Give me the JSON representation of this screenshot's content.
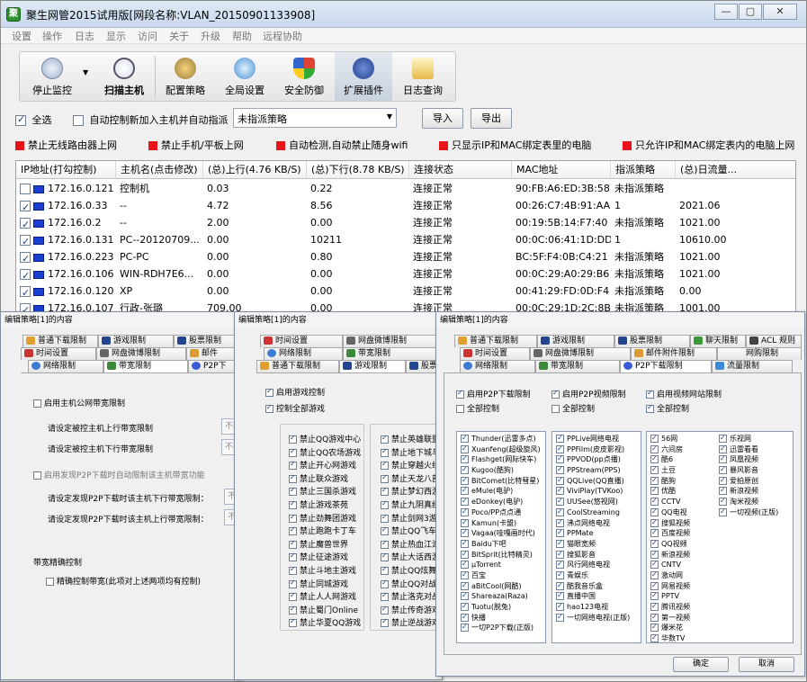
{
  "window": {
    "title": "聚生网管2015试用版[网段名称:VLAN_20150901133908]",
    "controls": [
      "—",
      "▢",
      "✕"
    ]
  },
  "menu": [
    "设置",
    "操作",
    "日志",
    "显示",
    "访问",
    "关于",
    "升级",
    "帮助",
    "远程协助"
  ],
  "toolbar": {
    "stop_monitor": "停止监控",
    "scan_host": "扫描主机",
    "config_policy": "配置策略",
    "global_settings": "全局设置",
    "security": "安全防御",
    "plugins": "扩展插件",
    "log_query": "日志查询"
  },
  "options": {
    "select_all": "全选",
    "auto_control": "自动控制新加入主机并自动指派",
    "policy_value": "未指派策略",
    "import": "导入",
    "export": "导出"
  },
  "flags": [
    "禁止无线路由器上网",
    "禁止手机/平板上网",
    "自动检测,自动禁止随身wifi",
    "只显示IP和MAC绑定表里的电脑",
    "只允许IP和MAC绑定表内的电脑上网"
  ],
  "table": {
    "headers": [
      "IP地址(打勾控制)",
      "主机名(点击修改)",
      "(总)上行(4.76 KB/S)",
      "(总)下行(8.78 KB/S)",
      "连接状态",
      "MAC地址",
      "指派策略",
      "(总)日流量..."
    ],
    "rows": [
      {
        "checked": false,
        "ip": "172.16.0.121",
        "host": "控制机",
        "up": "0.03",
        "down": "0.22",
        "status": "连接正常",
        "mac": "90:FB:A6:ED:3B:58",
        "policy": "未指派策略",
        "traffic": ""
      },
      {
        "checked": true,
        "ip": "172.16.0.33",
        "host": "--",
        "up": "4.72",
        "down": "8.56",
        "status": "连接正常",
        "mac": "00:26:C7:4B:91:AA",
        "policy": "1",
        "traffic": "2021.06"
      },
      {
        "checked": true,
        "ip": "172.16.0.2",
        "host": "--",
        "up": "2.00",
        "down": "0.00",
        "status": "连接正常",
        "mac": "00:19:5B:14:F7:40",
        "policy": "未指派策略",
        "traffic": "1021.00"
      },
      {
        "checked": true,
        "ip": "172.16.0.131",
        "host": "PC--20120709...",
        "up": "0.00",
        "down": "10211",
        "status": "连接正常",
        "mac": "00:0C:06:41:1D:DD",
        "policy": "1",
        "traffic": "10610.00"
      },
      {
        "checked": true,
        "ip": "172.16.0.223",
        "host": "PC-PC",
        "up": "0.00",
        "down": "0.80",
        "status": "连接正常",
        "mac": "BC:5F:F4:0B:C4:21",
        "policy": "未指派策略",
        "traffic": "1021.00"
      },
      {
        "checked": true,
        "ip": "172.16.0.106",
        "host": "WIN-RDH7E6...",
        "up": "0.00",
        "down": "0.00",
        "status": "连接正常",
        "mac": "00:0C:29:A0:29:B6",
        "policy": "未指派策略",
        "traffic": "1021.00"
      },
      {
        "checked": true,
        "ip": "172.16.0.120",
        "host": "XP",
        "up": "0.00",
        "down": "0.00",
        "status": "连接正常",
        "mac": "00:41:29:FD:0D:F4",
        "policy": "未指派策略",
        "traffic": "0.00"
      },
      {
        "checked": true,
        "ip": "172.16.0.107",
        "host": "行政-张璐",
        "up": "709.00",
        "down": "0.00",
        "status": "连接正常",
        "mac": "00:0C:29:1D:2C:8B",
        "policy": "未指派策略",
        "traffic": "1001.00"
      }
    ]
  },
  "dialog1": {
    "title": "编辑策略[1]的内容",
    "tabs_row1": [
      "普通下载限制",
      "游戏限制",
      "股票限制"
    ],
    "tabs_row2": [
      "时间设置",
      "网盘微博限制",
      "邮件"
    ],
    "tabs_row3": [
      "网络限制",
      "带宽限制",
      "P2P下"
    ],
    "enable_bandwidth": "启用主机公网带宽限制",
    "up_limit": "请设定被控主机上行带宽限制",
    "down_limit": "请设定被控主机下行带宽限制",
    "field_value": "不l",
    "p2p_enable": "启用发现P2P下载时自动限制该主机带宽功能",
    "p2p_down": "请设定发现P2P下载时该主机下行带宽限制：",
    "p2p_up": "请设定发现P2P下载时该主机上行带宽限制：",
    "field_value2": "不",
    "precise_title": "带宽精确控制",
    "precise_cb": "精确控制带宽(此项对上述两项均有控制)"
  },
  "dialog2": {
    "title": "编辑策略[1]的内容",
    "tabs_row1": [
      "时间设置",
      "网盘微博限制"
    ],
    "tabs_row2": [
      "网络限制",
      "带宽限制"
    ],
    "tabs_row3": [
      "普通下载限制",
      "游戏限制",
      "股票限"
    ],
    "enable_game": "启用游戏控制",
    "control_all": "控制全部游戏",
    "games_left": [
      "禁止QQ游戏中心",
      "禁止QQ农场游戏",
      "禁止开心网游戏",
      "禁止联众游戏",
      "禁止三国杀游戏",
      "禁止游戏茶苑",
      "禁止劲舞团游戏",
      "禁止跑跑卡丁车",
      "禁止魔兽世界",
      "禁止征途游戏",
      "禁止斗地主游戏",
      "禁止同城游戏",
      "禁止人人网游戏",
      "禁止蜀门Online",
      "禁止华夏QQ游戏"
    ],
    "games_right": [
      "禁止英雄联盟",
      "禁止地下城与",
      "禁止穿越火线",
      "禁止天龙八部",
      "禁止梦幻西游",
      "禁止九阴真经",
      "禁止剑网3游戏",
      "禁止QQ飞车",
      "禁止热血江湖",
      "禁止大话西游",
      "禁止QQ炫舞",
      "禁止QQ对战",
      "禁止洛克对战",
      "禁止传奇游戏",
      "禁止逆战游戏"
    ]
  },
  "dialog3": {
    "title": "编辑策略[1]的内容",
    "tabs_row1": [
      "普通下载限制",
      "游戏限制",
      "股票限制",
      "聊天限制",
      "ACL 规则"
    ],
    "tabs_row2": [
      "时间设置",
      "网盘微博限制",
      "邮件附件限制",
      "网购限制"
    ],
    "tabs_row3": [
      "网络限制",
      "带宽限制",
      "P2P下载限制",
      "流量限制"
    ],
    "enable_p2p": "启用P2P下载限制",
    "all_p2p": "全部控制",
    "enable_p2p_video": "启用P2P视频限制",
    "all_p2p_video": "全部控制",
    "enable_video_site": "启用视频网站限制",
    "all_video_site": "全部控制",
    "p2p_list": [
      "Thunder(迅雷多点)",
      "Xuanfeng(超级旋风)",
      "Flashget(网际快车)",
      "Kugoo(酷狗)",
      "BitComet(比特彗星)",
      "eMule(电驴)",
      "eDonkey(电驴)",
      "Poco/PP点点通",
      "Kamun(卡盟)",
      "Vagaa(哇嘎画时代)",
      "Baidu下吧",
      "BitSprit(比特精灵)",
      "μTorrent",
      "百宝",
      "aBitCool(网酷)",
      "Shareaza(Raza)",
      "Tuotu(脱兔)",
      "快播",
      "一切P2P下载(正版)"
    ],
    "p2p_checked": [
      true,
      true,
      true,
      true,
      true,
      true,
      true,
      true,
      true,
      true,
      true,
      true,
      true,
      true,
      true,
      true,
      true,
      true,
      true
    ],
    "video_list": [
      "PPLive网络电视",
      "PPFilm(皮皮影视)",
      "PPVOD(pp点播)",
      "PPStream(PPS)",
      "QQLive(QQ直播)",
      "ViviPlay(TVKoo)",
      "UUSee(悠视网)",
      "CoolStreaming",
      "沸点网络电视",
      "PPMate",
      "猫眼宽频",
      "搜狐影音",
      "风行网络电视",
      "青娱乐",
      "酷我音乐盒",
      "直播中国",
      "hao123电视",
      "一切网络电视(正版)"
    ],
    "video_checked": [
      true,
      true,
      true,
      true,
      true,
      true,
      true,
      true,
      true,
      true,
      true,
      true,
      true,
      true,
      true,
      true,
      true,
      true
    ],
    "sites_left": [
      "56网",
      "六间房",
      "酷6",
      "土豆",
      "酷狗",
      "优酷",
      "CCTV",
      "QQ电视",
      "搜狐视频",
      "百度视频",
      "QQ视频",
      "新浪视频",
      "CNTV",
      "激动网",
      "网易视频",
      "PPTV",
      "腾讯视频",
      "第一视频",
      "爆米花",
      "华数TV"
    ],
    "sites_right": [
      "乐视网",
      "迅雷看看",
      "凤凰视频",
      "暴风影音",
      "爱拍原创",
      "新浪视频",
      "淘米视频",
      "一切视频(正版)"
    ],
    "ok": "确定",
    "cancel": "取消"
  }
}
